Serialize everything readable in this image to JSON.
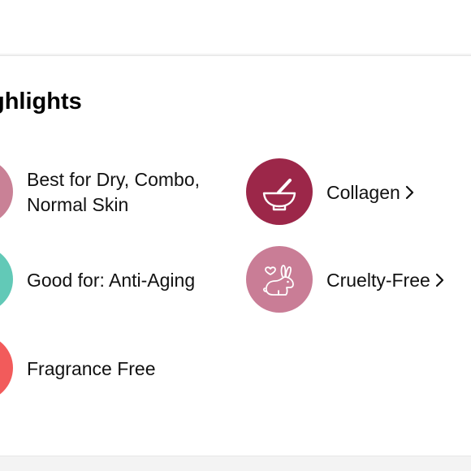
{
  "highlights": {
    "title": "ghlights",
    "items": [
      {
        "label_line1": "Best for Dry, Combo,",
        "label_line2": "Normal Skin",
        "color": "#c98196"
      },
      {
        "label": "Collagen",
        "color": "#9c2749",
        "icon": "mortar-bowl-icon"
      },
      {
        "label": "Good for: Anti-Aging",
        "color": "#62c9b7"
      },
      {
        "label": "Cruelty-Free",
        "color": "#c97d96",
        "icon": "bunny-heart-icon"
      },
      {
        "label": "Fragrance Free",
        "color": "#f25b5b"
      }
    ]
  }
}
